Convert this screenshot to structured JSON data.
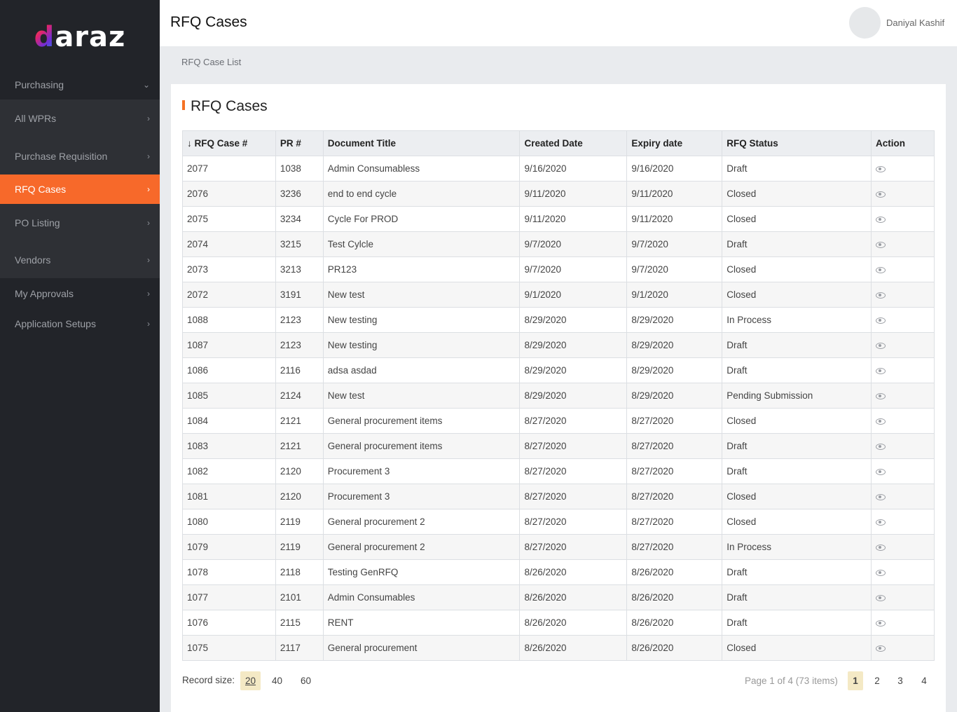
{
  "brand": {
    "logo_text": "daraz",
    "accent": "#f7692a"
  },
  "sidebar": {
    "items": [
      {
        "label": "Purchasing",
        "icon": "chevron-down-icon"
      },
      {
        "label": "All WPRs",
        "icon": "chevron-right-icon"
      },
      {
        "label": "Purchase Requisition",
        "icon": "chevron-right-icon"
      },
      {
        "label": "RFQ Cases",
        "icon": "chevron-right-icon",
        "active": true
      },
      {
        "label": "PO Listing",
        "icon": "chevron-right-icon"
      },
      {
        "label": "Vendors",
        "icon": "chevron-right-icon"
      },
      {
        "label": "My Approvals",
        "icon": "chevron-right-icon"
      },
      {
        "label": "Application Setups",
        "icon": "chevron-right-icon"
      }
    ]
  },
  "header": {
    "title": "RFQ Cases",
    "user_name": "Daniyal Kashif"
  },
  "breadcrumb": "RFQ Case List",
  "card": {
    "title": "RFQ Cases"
  },
  "table": {
    "columns": [
      "↓ RFQ Case #",
      "PR #",
      "Document Title",
      "Created Date",
      "Expiry date",
      "RFQ Status",
      "Action"
    ],
    "rows": [
      [
        "2077",
        "1038",
        "Admin Consumabless",
        "9/16/2020",
        "9/16/2020",
        "Draft"
      ],
      [
        "2076",
        "3236",
        "end to end cycle",
        "9/11/2020",
        "9/11/2020",
        "Closed"
      ],
      [
        "2075",
        "3234",
        "Cycle For PROD",
        "9/11/2020",
        "9/11/2020",
        "Closed"
      ],
      [
        "2074",
        "3215",
        "Test Cylcle",
        "9/7/2020",
        "9/7/2020",
        "Draft"
      ],
      [
        "2073",
        "3213",
        "PR123",
        "9/7/2020",
        "9/7/2020",
        "Closed"
      ],
      [
        "2072",
        "3191",
        "New test",
        "9/1/2020",
        "9/1/2020",
        "Closed"
      ],
      [
        "1088",
        "2123",
        "New testing",
        "8/29/2020",
        "8/29/2020",
        "In Process"
      ],
      [
        "1087",
        "2123",
        "New testing",
        "8/29/2020",
        "8/29/2020",
        "Draft"
      ],
      [
        "1086",
        "2116",
        "adsa asdad",
        "8/29/2020",
        "8/29/2020",
        "Draft"
      ],
      [
        "1085",
        "2124",
        "New test",
        "8/29/2020",
        "8/29/2020",
        "Pending Submission"
      ],
      [
        "1084",
        "2121",
        "General procurement items",
        "8/27/2020",
        "8/27/2020",
        "Closed"
      ],
      [
        "1083",
        "2121",
        "General procurement items",
        "8/27/2020",
        "8/27/2020",
        "Draft"
      ],
      [
        "1082",
        "2120",
        "Procurement 3",
        "8/27/2020",
        "8/27/2020",
        "Draft"
      ],
      [
        "1081",
        "2120",
        "Procurement 3",
        "8/27/2020",
        "8/27/2020",
        "Closed"
      ],
      [
        "1080",
        "2119",
        "General procurement 2",
        "8/27/2020",
        "8/27/2020",
        "Closed"
      ],
      [
        "1079",
        "2119",
        "General procurement 2",
        "8/27/2020",
        "8/27/2020",
        "In Process"
      ],
      [
        "1078",
        "2118",
        "Testing GenRFQ",
        "8/26/2020",
        "8/26/2020",
        "Draft"
      ],
      [
        "1077",
        "2101",
        "Admin Consumables",
        "8/26/2020",
        "8/26/2020",
        "Draft"
      ],
      [
        "1076",
        "2115",
        "RENT",
        "8/26/2020",
        "8/26/2020",
        "Draft"
      ],
      [
        "1075",
        "2117",
        "General procurement",
        "8/26/2020",
        "8/26/2020",
        "Closed"
      ]
    ],
    "action_icon": "eye-icon"
  },
  "pager": {
    "record_size_label": "Record size:",
    "record_sizes": [
      "20",
      "40",
      "60"
    ],
    "selected_size": "20",
    "page_info": "Page 1 of 4 (73 items)",
    "pages": [
      "1",
      "2",
      "3",
      "4"
    ],
    "current_page": "1"
  }
}
